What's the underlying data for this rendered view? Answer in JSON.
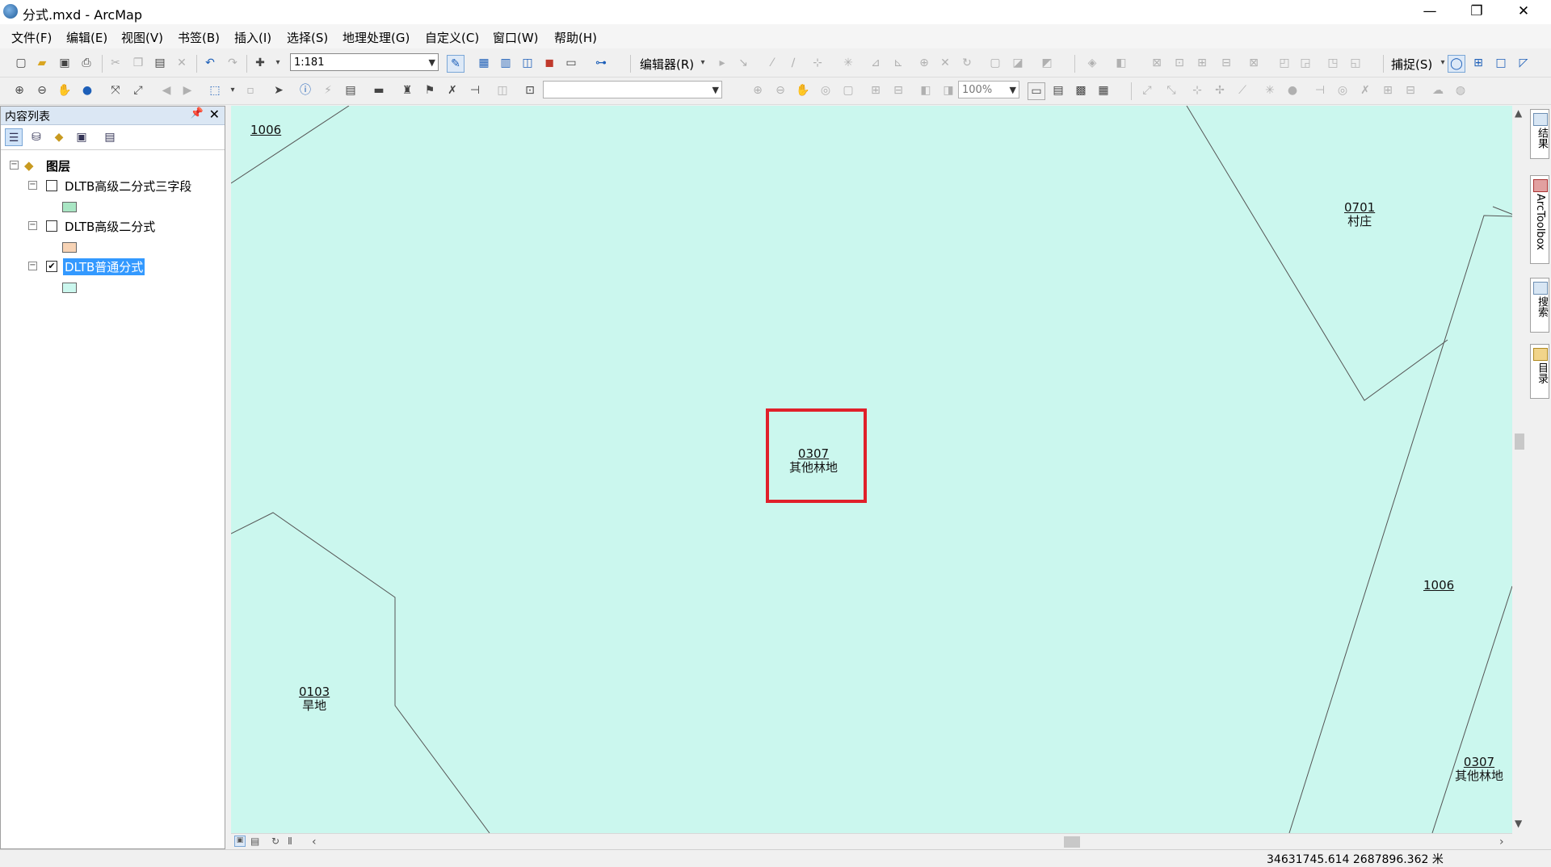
{
  "window": {
    "title": "分式.mxd - ArcMap",
    "minimize": "—",
    "restore": "❐",
    "close": "✕"
  },
  "menu": [
    "文件(F)",
    "编辑(E)",
    "视图(V)",
    "书签(B)",
    "插入(I)",
    "选择(S)",
    "地理处理(G)",
    "自定义(C)",
    "窗口(W)",
    "帮助(H)"
  ],
  "toolbar1": {
    "scale": "1:181",
    "editor_label": "编辑器(R)",
    "snapping_label": "捕捉(S)"
  },
  "toolbar2": {
    "zoom": "100%",
    "combo_value": ""
  },
  "toc": {
    "title": "内容列表",
    "group_label": "图层",
    "layers": [
      {
        "name": "DLTB高级二分式三字段",
        "checked": false,
        "swatch": "#a9e6c4"
      },
      {
        "name": "DLTB高级二分式",
        "checked": false,
        "swatch": "#f7d3b5"
      },
      {
        "name": "DLTB普通分式",
        "checked": true,
        "swatch": "#cbf7ee"
      }
    ]
  },
  "map": {
    "fill_color": "#cbf7ee",
    "labels": [
      {
        "code": "1006",
        "name": ""
      },
      {
        "code": "0701",
        "name": "村庄"
      },
      {
        "code": "0307",
        "name": "其他林地"
      },
      {
        "code": "1006",
        "name": ""
      },
      {
        "code": "0103",
        "name": "旱地"
      },
      {
        "code": "0307",
        "name": "其他林地"
      }
    ],
    "highlight_color": "#e0202a"
  },
  "rightdock": [
    "结果",
    "ArcToolbox",
    "搜索",
    "目录"
  ],
  "status": {
    "coords": "34631745.614  2687896.362 米"
  }
}
